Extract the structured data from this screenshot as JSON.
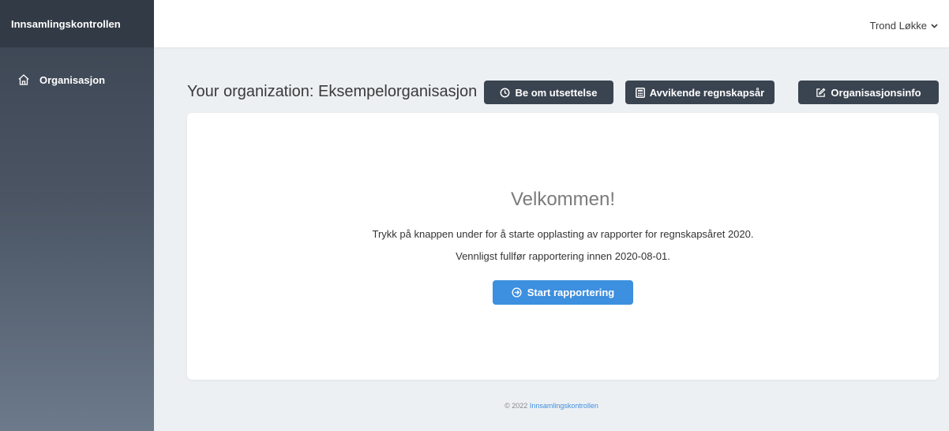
{
  "app": {
    "brand": "Innsamlingskontrollen"
  },
  "sidebar": {
    "items": [
      {
        "label": "Organisasjon",
        "icon": "home-icon"
      }
    ]
  },
  "topbar": {
    "user_name": "Trond Løkke"
  },
  "header": {
    "title": "Your organization: Eksempelorganisasjon",
    "buttons": {
      "postpone": {
        "label": "Be om utsettelse",
        "icon": "clock-icon"
      },
      "fiscal_year": {
        "label": "Avvikende regnskapsår",
        "icon": "calculator-icon"
      },
      "org_info": {
        "label": "Organisasjonsinfo",
        "icon": "edit-icon"
      }
    }
  },
  "main": {
    "welcome": "Velkommen!",
    "line1": "Trykk på knappen under for å starte opplasting av rapporter for regnskapsåret 2020.",
    "line2": "Vennligst fullfør rapportering innen 2020-08-01.",
    "start_button": {
      "label": "Start rapportering",
      "icon": "arrow-circle-right-icon"
    }
  },
  "footer": {
    "copyright": "© 2022",
    "link": "Innsamlingskontrollen"
  },
  "colors": {
    "sidebar": "#3b4451",
    "dark_button": "#3a4350",
    "accent": "#3d8fdf",
    "background": "#edf0f3"
  }
}
